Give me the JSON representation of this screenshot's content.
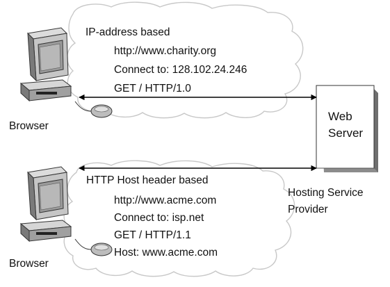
{
  "top_client": {
    "caption": "Browser",
    "method_title": "IP-address based",
    "request_lines": [
      "http://www.charity.org",
      "Connect to: 128.102.24.246",
      "GET / HTTP/1.0"
    ]
  },
  "bottom_client": {
    "caption": "Browser",
    "method_title": "HTTP Host header based",
    "request_lines": [
      "http://www.acme.com",
      "Connect to: isp.net",
      "GET / HTTP/1.1",
      "Host: www.acme.com"
    ]
  },
  "server": {
    "label_line1": "Web",
    "label_line2": "Server",
    "provider_line1": "Hosting Service",
    "provider_line2": "Provider"
  },
  "colors": {
    "cloud_outline": "#c8c8c8",
    "monitor_face": "#c6c6c6",
    "monitor_dark": "#7a7a7a",
    "screen": "#9a9a9a",
    "server_shadow": "#8c8c8c",
    "arrow": "#000000"
  },
  "icons": {
    "client": "desktop-computer-icon",
    "mouse": "mouse-icon",
    "server": "server-document-icon",
    "cloud": "cloud-icon"
  }
}
